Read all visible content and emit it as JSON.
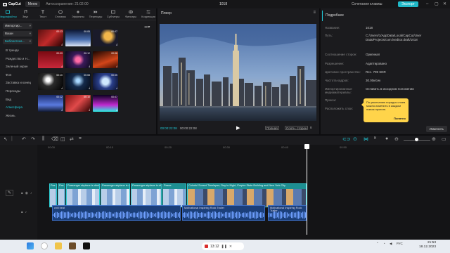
{
  "titlebar": {
    "app": "CapCut",
    "menu": "Меню",
    "autosave": "Автосохранение: 21:02:00",
    "project": "1018",
    "shortcuts": "Сочетания клавиш",
    "export": "Экспорт"
  },
  "tabs": [
    {
      "label": "Медиафайлы",
      "icon": "media-icon"
    },
    {
      "label": "Звук",
      "icon": "music-icon"
    },
    {
      "label": "Текст",
      "icon": "text-icon"
    },
    {
      "label": "Стикеры",
      "icon": "sticker-icon"
    },
    {
      "label": "Эффекты",
      "icon": "effects-icon"
    },
    {
      "label": "Переходы",
      "icon": "transition-icon"
    },
    {
      "label": "Субтитры",
      "icon": "subtitle-icon"
    },
    {
      "label": "Фильтры",
      "icon": "filter-icon"
    },
    {
      "label": "Коррекция",
      "icon": "adjust-icon"
    }
  ],
  "sidebar": {
    "dropdowns": [
      "Импортир...",
      "Ваши",
      "Библиотека..."
    ],
    "categories": [
      "В тренде",
      "Рождество и Н...",
      "Зеленый экран",
      "Фон",
      "Заставка и конец",
      "Переходы",
      "Вид",
      "Атмосфера",
      "Жизнь"
    ],
    "active_category": "Атмосфера"
  },
  "library": {
    "thumbs": [
      {
        "dur": "00:13"
      },
      {
        "dur": "00:05"
      },
      {
        "dur": "00:07"
      },
      {
        "dur": "00:09"
      },
      {
        "dur": "00:12"
      },
      {
        "dur": "00:06"
      },
      {
        "dur": "00:10"
      },
      {
        "dur": "00:08"
      },
      {
        "dur": "00:05"
      },
      {
        "dur": "00:12"
      },
      {
        "dur": "00:10"
      },
      {
        "dur": "00:07"
      }
    ]
  },
  "player": {
    "title": "Плеер",
    "current_time": "00:00:22:08",
    "total_time": "00:00:22:08",
    "zoom": "8",
    "full_label": "Полная",
    "aspect_label": "Соотн. сторон"
  },
  "details": {
    "header": "Подробнее",
    "rows": [
      {
        "label": "Название:",
        "value": "1018"
      },
      {
        "label": "Путь:",
        "value": "C:/Users/1/AppData/Local/CapCut/User Data/Projects/com.lveditor.draft/1018"
      },
      {
        "label": "Соотношение сторон:",
        "value": "Оригинал"
      },
      {
        "label": "Разрешение:",
        "value": "Адаптировано"
      },
      {
        "label": "Цветовое пространство:",
        "value": "Rec. 709 SDR"
      },
      {
        "label": "Частота кадров:",
        "value": "30.00к/сек"
      },
      {
        "label": "Импортированные медиаматериалы:",
        "value": "Оставить в исходном положении"
      },
      {
        "label": "Прокси:",
        "value": ""
      },
      {
        "label": "Расположить слои:",
        "value": ""
      }
    ],
    "change_button": "Изменить"
  },
  "tooltip": {
    "text": "По умолчанию порядок слоев можно изменить в каждом новом проекте.",
    "ok": "Понятно"
  },
  "timeline": {
    "ruler": [
      "00:00",
      "00:10",
      "00:20",
      "00:30",
      "00:40",
      "00:50"
    ],
    "video_clips": [
      {
        "title": "Pas"
      },
      {
        "title": "Pas"
      },
      {
        "title": "Passenger airplane is climbing after take"
      },
      {
        "title": "Passenger airplane is climbing after take"
      },
      {
        "title": "Passenger airplane is climbing after take"
      },
      {
        "title": "Passe"
      },
      {
        "title": "Colorful Sunset Timelapse, Day to Night, Empire State Building and New York City"
      }
    ],
    "audio_clips": [
      {
        "title": "chill beat"
      },
      {
        "title": "Motivational Inspiring Rock Trailer"
      },
      {
        "title": "Motivational Inspiring Rock Trailer"
      }
    ]
  },
  "taskbar": {
    "recording": "13:12",
    "lang": "РУС",
    "time": "21:53",
    "date": "18.12.2023"
  }
}
